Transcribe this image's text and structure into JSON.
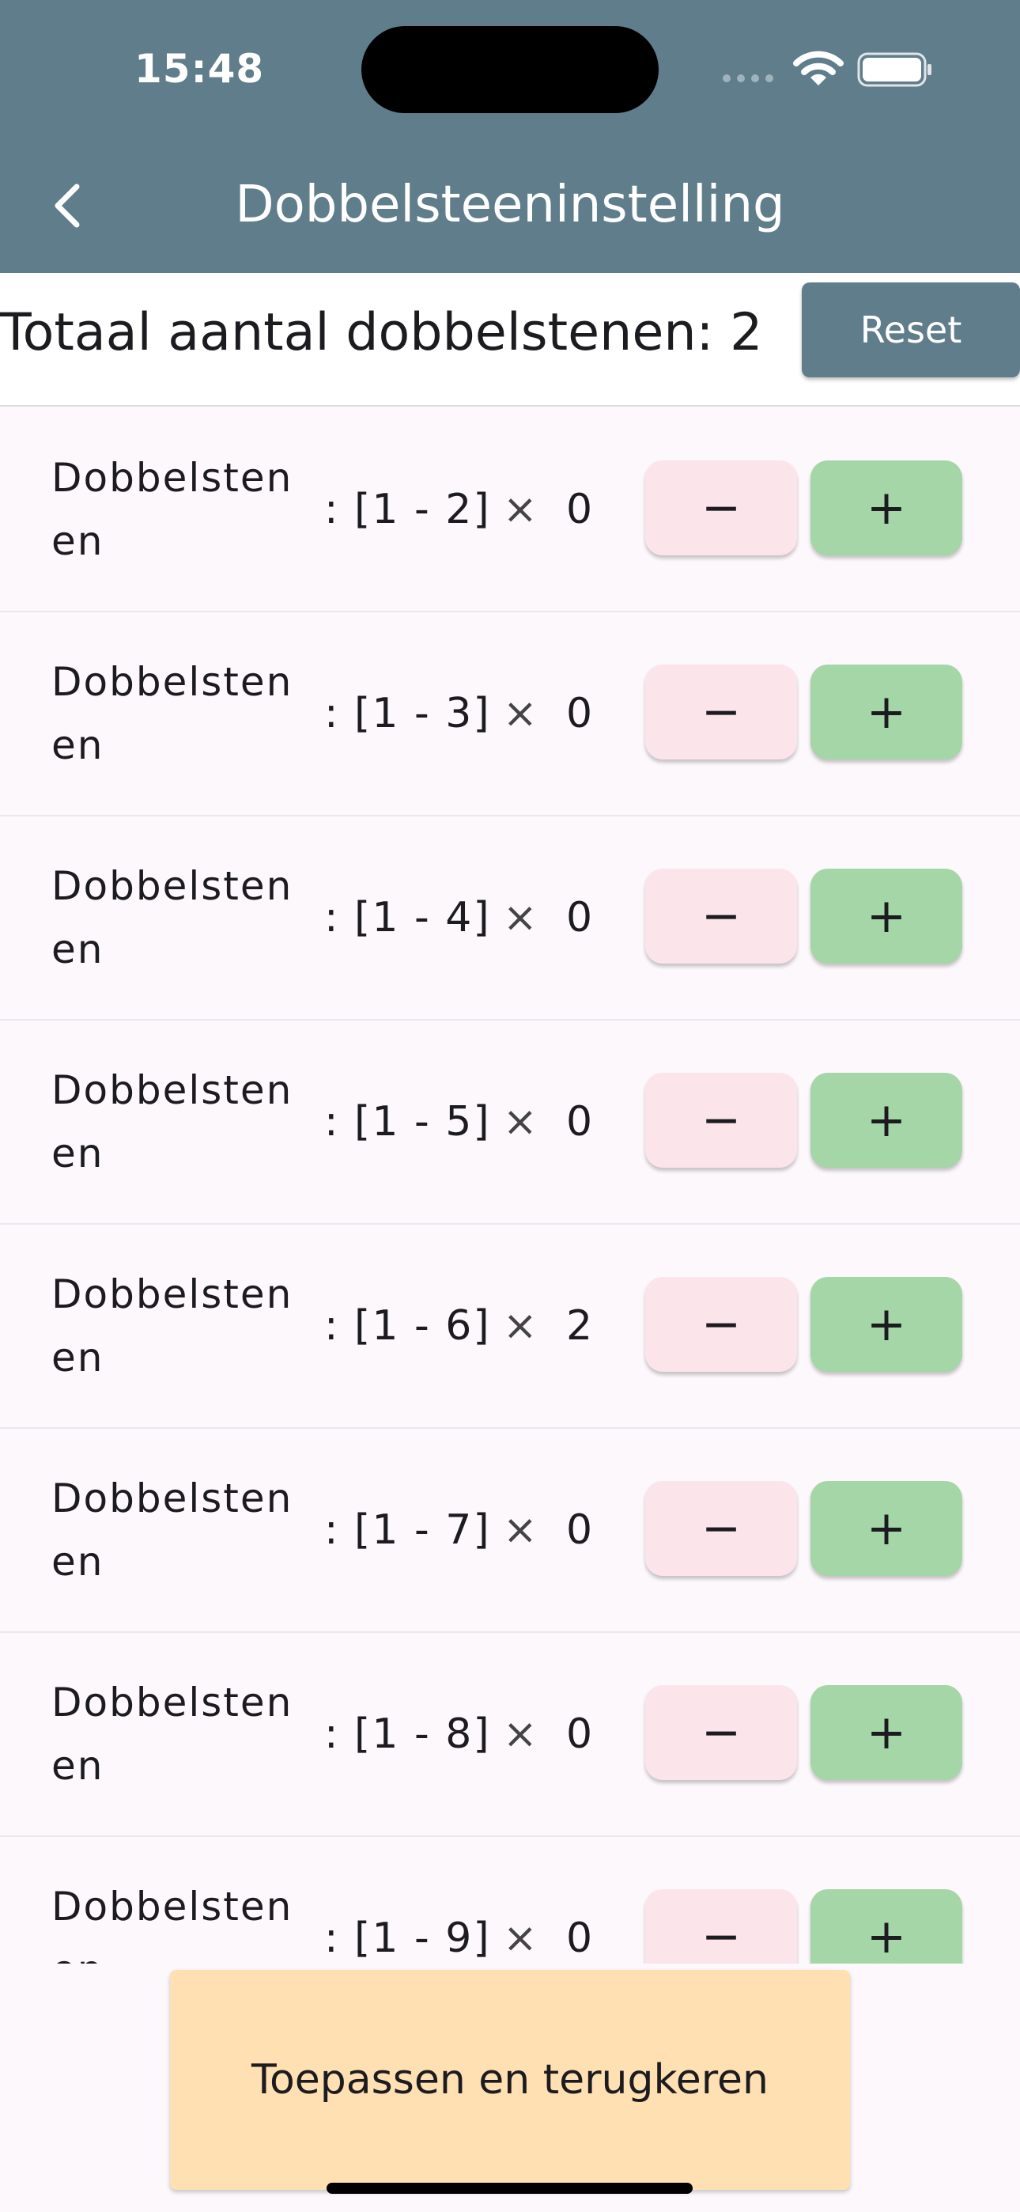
{
  "status_bar": {
    "time": "15:48"
  },
  "app_bar": {
    "title": "Dobbelsteeninstelling",
    "back_icon": "chevron-left-icon"
  },
  "summary": {
    "total_text": "Totaal aantal dobbelstenen: 2",
    "reset_label": "Reset"
  },
  "dice_rows": [
    {
      "label": "Dobbelstenen",
      "range": ": [1 - 2]",
      "times": "×",
      "count": "0",
      "minus": "−",
      "plus": "+"
    },
    {
      "label": "Dobbelstenen",
      "range": ": [1 - 3]",
      "times": "×",
      "count": "0",
      "minus": "−",
      "plus": "+"
    },
    {
      "label": "Dobbelstenen",
      "range": ": [1 - 4]",
      "times": "×",
      "count": "0",
      "minus": "−",
      "plus": "+"
    },
    {
      "label": "Dobbelstenen",
      "range": ": [1 - 5]",
      "times": "×",
      "count": "0",
      "minus": "−",
      "plus": "+"
    },
    {
      "label": "Dobbelstenen",
      "range": ": [1 - 6]",
      "times": "×",
      "count": "2",
      "minus": "−",
      "plus": "+"
    },
    {
      "label": "Dobbelstenen",
      "range": ": [1 - 7]",
      "times": "×",
      "count": "0",
      "minus": "−",
      "plus": "+"
    },
    {
      "label": "Dobbelstenen",
      "range": ": [1 - 8]",
      "times": "×",
      "count": "0",
      "minus": "−",
      "plus": "+"
    },
    {
      "label": "Dobbelstenen",
      "range": ": [1 - 9]",
      "times": "×",
      "count": "0",
      "minus": "−",
      "plus": "+"
    }
  ],
  "apply_button": {
    "label": "Toepassen en terugkeren"
  },
  "colors": {
    "app_bar": "#607d8b",
    "minus_button": "#fbe4ea",
    "plus_button": "#a5d6a7",
    "apply_button": "#ffe0b2",
    "background": "#fdf8fc"
  }
}
